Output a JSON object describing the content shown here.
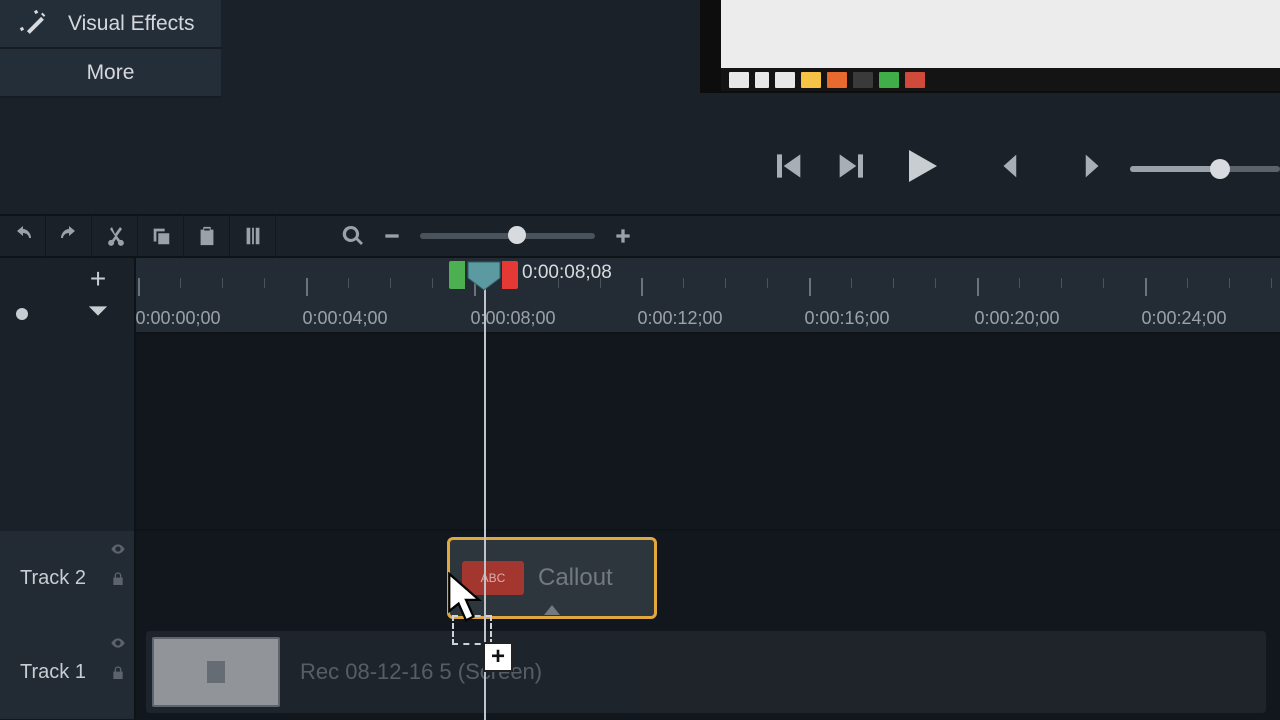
{
  "sidebar": {
    "visual_effects": "Visual Effects",
    "more": "More"
  },
  "playback": {
    "timecode": "0:00:08;08"
  },
  "ruler": {
    "labels": [
      "0:00:00;00",
      "0:00:04;00",
      "0:00:08;00",
      "0:00:12;00",
      "0:00:16;00",
      "0:00:20;00",
      "0:00:24;00"
    ]
  },
  "tracks": {
    "t2_label": "Track 2",
    "t1_label": "Track 1",
    "callout_label": "Callout",
    "callout_tag": "ABC",
    "media_label": "Rec 08-12-16 5 (Screen)"
  },
  "taskbar": {
    "colors": [
      "#e8e8e8",
      "#e8e8e8",
      "#e8e8e8",
      "#f7c344",
      "#e86a2e",
      "#2f2f2f",
      "#3fae49",
      "#d04a3c"
    ]
  }
}
